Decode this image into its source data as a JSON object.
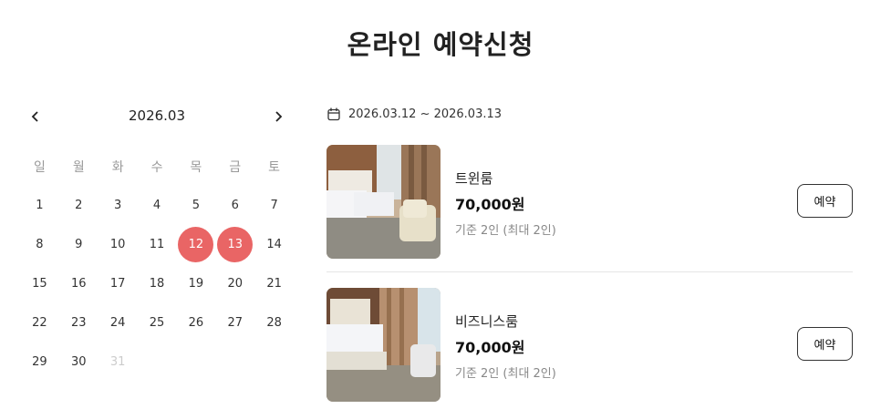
{
  "page": {
    "title": "온라인 예약신청"
  },
  "calendar": {
    "month_label": "2026.03",
    "weekdays": [
      "일",
      "월",
      "화",
      "수",
      "목",
      "금",
      "토"
    ],
    "weeks": [
      [
        "1",
        "2",
        "3",
        "4",
        "5",
        "6",
        "7"
      ],
      [
        "8",
        "9",
        "10",
        "11",
        "12",
        "13",
        "14"
      ],
      [
        "15",
        "16",
        "17",
        "18",
        "19",
        "20",
        "21"
      ],
      [
        "22",
        "23",
        "24",
        "25",
        "26",
        "27",
        "28"
      ],
      [
        "29",
        "30",
        "31",
        "",
        "",
        "",
        ""
      ]
    ],
    "selected_days": [
      "12",
      "13"
    ],
    "disabled_days": [
      "31"
    ],
    "accent_color": "#e96565"
  },
  "selection": {
    "date_range": "2026.03.12 ~ 2026.03.13"
  },
  "rooms": [
    {
      "name": "트윈룸",
      "price": "70,000원",
      "capacity": "기준 2인 (최대 2인)",
      "button": "예약"
    },
    {
      "name": "비즈니스룸",
      "price": "70,000원",
      "capacity": "기준 2인 (최대 2인)",
      "button": "예약"
    }
  ]
}
